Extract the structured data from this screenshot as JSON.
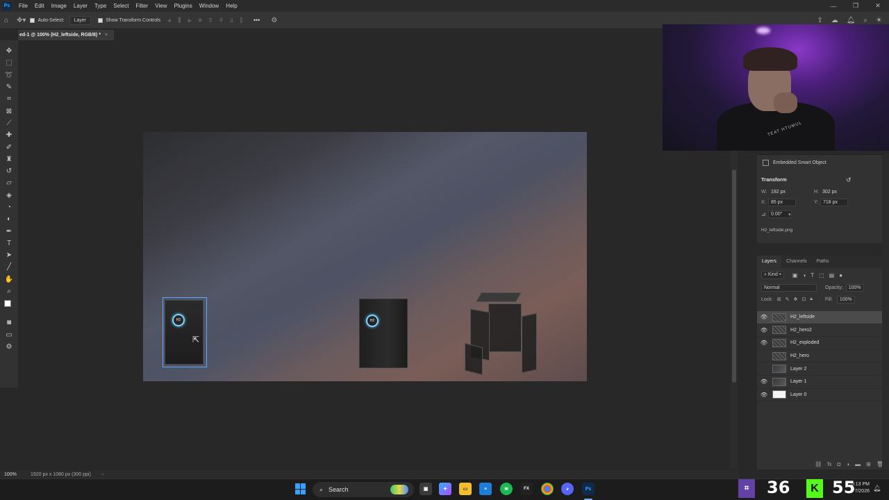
{
  "menu": {
    "logo": "Ps",
    "items": [
      "File",
      "Edit",
      "Image",
      "Layer",
      "Type",
      "Select",
      "Filter",
      "View",
      "Plugins",
      "Window",
      "Help"
    ]
  },
  "window_controls": {
    "minimize": "—",
    "restore": "❐",
    "close": "✕"
  },
  "options_bar": {
    "auto_select_label": "Auto-Select:",
    "auto_select_target": "Layer",
    "show_transform_label": "Show Transform Controls",
    "more": "•••"
  },
  "document": {
    "tab_title": "ed-1 @ 100% (H2_leftside, RGB/8) *",
    "tab_close": "×"
  },
  "status": {
    "zoom": "100%",
    "doc_size": "1920 px x 1080 px (300 ppi)",
    "arrow": "›"
  },
  "canvas": {
    "fan_label": "H2"
  },
  "properties": {
    "header": "Embedded Smart Object",
    "section": "Transform",
    "w_label": "W:",
    "w_value": "192 px",
    "h_label": "H:",
    "h_value": "302 px",
    "x_label": "X:",
    "x_value": "85 px",
    "y_label": "Y:",
    "y_value": "718 px",
    "angle_value": "0.00°",
    "filename": "H2_leftside.png"
  },
  "layers_panel": {
    "tabs": [
      "Layers",
      "Channels",
      "Paths"
    ],
    "filter_kind": "Kind",
    "blend_mode": "Normal",
    "opacity_label": "Opacity:",
    "opacity_value": "100%",
    "lock_label": "Lock:",
    "fill_label": "Fill:",
    "fill_value": "100%",
    "layers": [
      {
        "name": "H2_leftside",
        "visible": true,
        "thumb": "smart",
        "selected": true
      },
      {
        "name": "H2_hero2",
        "visible": true,
        "thumb": "smart",
        "selected": false
      },
      {
        "name": "H2_exploded",
        "visible": true,
        "thumb": "smart",
        "selected": false
      },
      {
        "name": "H2_hero",
        "visible": false,
        "thumb": "smart",
        "selected": false
      },
      {
        "name": "Layer 2",
        "visible": false,
        "thumb": "dark",
        "selected": false
      },
      {
        "name": "Layer 1",
        "visible": true,
        "thumb": "dark",
        "selected": false
      },
      {
        "name": "Layer 0",
        "visible": true,
        "thumb": "white",
        "selected": false
      }
    ]
  },
  "taskbar": {
    "search_placeholder": "Search",
    "clock_time": "5:13 PM",
    "clock_date": "7/2026"
  },
  "stream_overlay": {
    "count_a": "36",
    "count_b": "55",
    "k_label": "K"
  },
  "webcam": {
    "shirt_text": "TEAT HTUMUL"
  },
  "colors": {
    "accent": "#31a8ff",
    "selection": "#5aa8ff",
    "twitch": "#6441a5",
    "kick": "#53fc18"
  }
}
